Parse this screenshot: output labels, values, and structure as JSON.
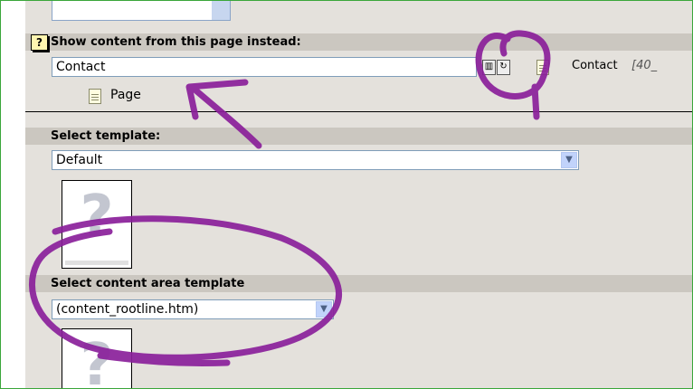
{
  "show_content": {
    "header": "Show content from this page instead:",
    "help_icon": "?",
    "field_value": "Contact",
    "page_label": "Page",
    "linked_title": "Contact",
    "linked_id": "[40_"
  },
  "template": {
    "header": "Select template:",
    "selected": "Default"
  },
  "content_area": {
    "header": "Select content area template",
    "selected": "(content_rootline.htm)"
  },
  "icons": {
    "help": "question-icon",
    "delete": "trash-icon",
    "browse": "browse-icon",
    "page": "page-icon",
    "dropdown": "chevron-down-icon"
  },
  "colors": {
    "panel_bg": "#e4e1dc",
    "header_bg": "#cbc7c0",
    "frame_border": "#3aa63a",
    "annotation": "#8a1f9a"
  }
}
